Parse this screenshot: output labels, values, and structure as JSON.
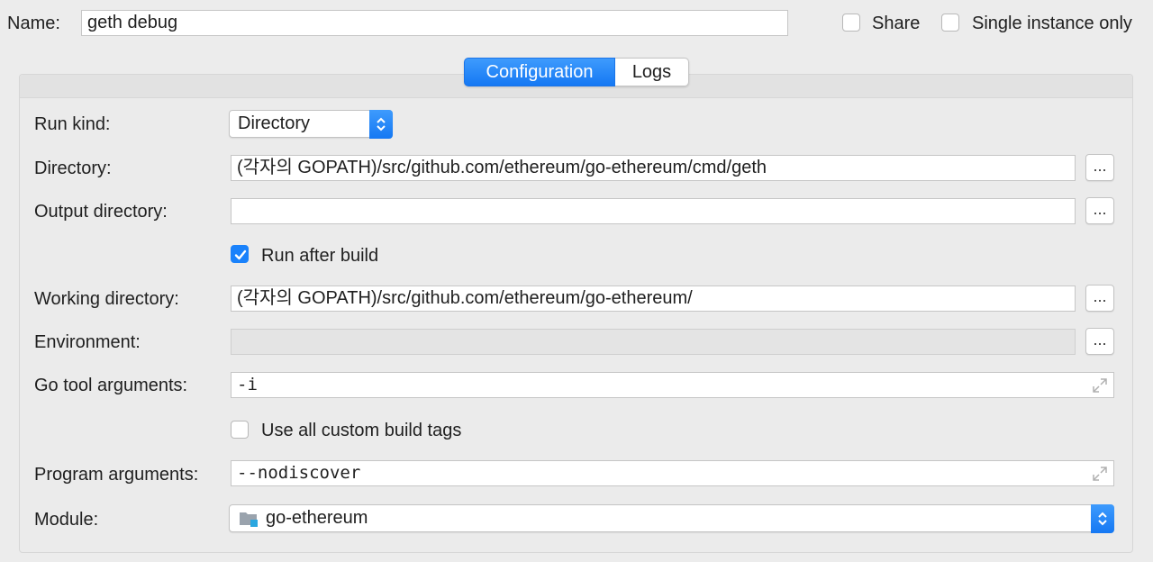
{
  "header": {
    "name_label": "Name:",
    "name_value": "geth debug",
    "share_label": "Share",
    "share_checked": false,
    "single_instance_label": "Single instance only",
    "single_instance_checked": false
  },
  "tabs": [
    {
      "label": "Configuration",
      "active": true
    },
    {
      "label": "Logs",
      "active": false
    }
  ],
  "form": {
    "run_kind": {
      "label": "Run kind:",
      "value": "Directory"
    },
    "directory": {
      "label": "Directory:",
      "value": "(각자의 GOPATH)/src/github.com/ethereum/go-ethereum/cmd/geth",
      "browse": "..."
    },
    "output_directory": {
      "label": "Output directory:",
      "value": "",
      "browse": "..."
    },
    "run_after_build": {
      "label": "Run after build",
      "checked": true
    },
    "working_directory": {
      "label": "Working directory:",
      "value": "(각자의 GOPATH)/src/github.com/ethereum/go-ethereum/",
      "browse": "..."
    },
    "environment": {
      "label": "Environment:",
      "value": "",
      "browse": "..."
    },
    "go_tool_arguments": {
      "label": "Go tool arguments:",
      "value": "-i"
    },
    "use_custom_build_tags": {
      "label": "Use all custom build tags",
      "checked": false
    },
    "program_arguments": {
      "label": "Program arguments:",
      "value": "--nodiscover"
    },
    "module": {
      "label": "Module:",
      "value": "go-ethereum"
    }
  },
  "icons": {
    "checkmark": "checkmark-icon",
    "stepper": "chevron-up-down-icon",
    "expand": "expand-icon",
    "module": "module-folder-icon"
  },
  "colors": {
    "accent": "#1a82fb",
    "background": "#ececec"
  }
}
